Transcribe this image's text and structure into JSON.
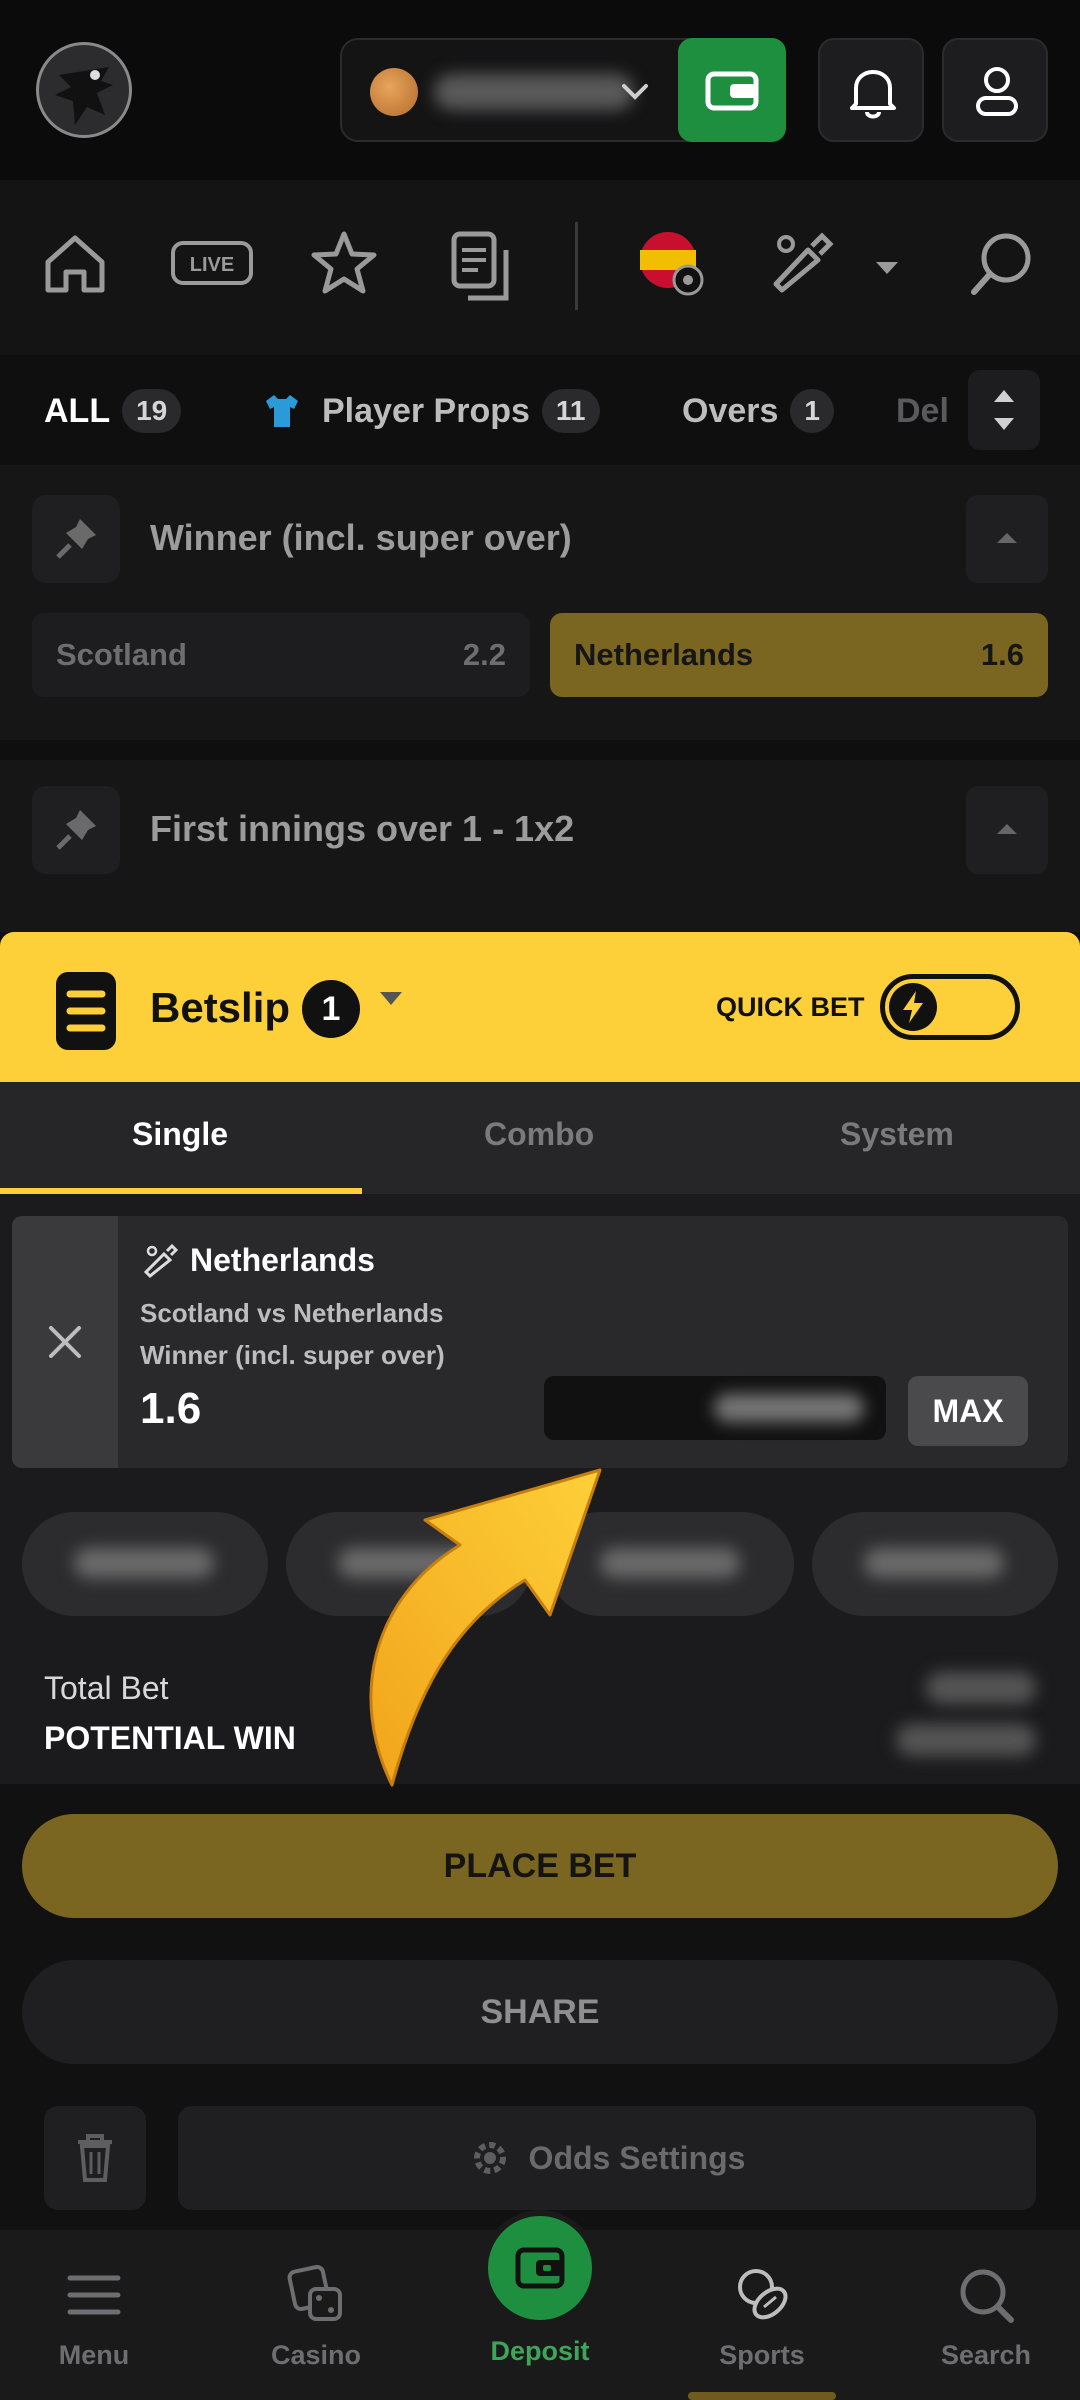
{
  "navrow": {
    "live_label": "LIVE"
  },
  "chips": [
    {
      "label": "ALL",
      "count": "19"
    },
    {
      "label": "Player Props",
      "count": "11"
    },
    {
      "label": "Overs",
      "count": "1"
    },
    {
      "label": "Del",
      "count": ""
    }
  ],
  "markets": [
    {
      "title": "Winner (incl. super over)",
      "odds": [
        {
          "team": "Scotland",
          "price": "2.2"
        },
        {
          "team": "Netherlands",
          "price": "1.6",
          "selected": true
        }
      ]
    },
    {
      "title": "First innings over 1 - 1x2"
    }
  ],
  "betslip": {
    "title": "Betslip",
    "count": "1",
    "quick_bet_label": "QUICK BET",
    "tabs": [
      "Single",
      "Combo",
      "System"
    ],
    "active_tab": "Single",
    "selection": {
      "name": "Netherlands",
      "match": "Scotland vs Netherlands",
      "market": "Winner (incl. super over)",
      "odds": "1.6",
      "max_label": "MAX"
    },
    "total_bet_label": "Total Bet",
    "potential_win_label": "POTENTIAL WIN",
    "place_bet_label": "PLACE BET",
    "share_label": "SHARE",
    "odds_settings_label": "Odds Settings"
  },
  "bottom_nav": {
    "menu": "Menu",
    "casino": "Casino",
    "deposit": "Deposit",
    "sports": "Sports",
    "search": "Search"
  },
  "colors": {
    "accent_yellow": "#fdd039",
    "deposit_green": "#1e8f3f",
    "selected_odd": "#7b6621"
  }
}
